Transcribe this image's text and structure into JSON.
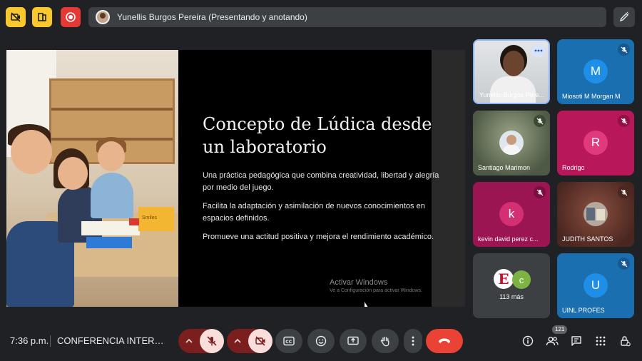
{
  "top_bar": {
    "presenter_status": "Yunellis Burgos Pereira (Presentando y anotando)"
  },
  "slide": {
    "title": "Concepto de Lúdica desde un laboratorio",
    "bullets": [
      "Una práctica pedagógica que combina creatividad, libertad y alegría por medio del juego.",
      "Facilita la adaptación y asimilación de nuevos conocimientos en espacios definidos.",
      "Promueve una actitud positiva y mejora el rendimiento académico."
    ],
    "toy_label": "Smiles",
    "watermark_title": "Activar Windows",
    "watermark_subtitle": "Ve a Configuración para activar Windows."
  },
  "participants": [
    {
      "name": "Yunellis Burgos Pere...",
      "type": "video"
    },
    {
      "name": "Miosoti M Morgan M",
      "initial": "M",
      "tile_color": "#1a6fb0",
      "avatar_color": "#1f8ee6"
    },
    {
      "name": "Santiago Marimon",
      "type": "video"
    },
    {
      "name": "Rodrigo",
      "initial": "R",
      "tile_color": "#b8185a",
      "avatar_color": "#e03a7c"
    },
    {
      "name": "kevin david perez c...",
      "initial": "k",
      "tile_color": "#9b1552",
      "avatar_color": "#d42f73"
    },
    {
      "name": "JUDITH SANTOS",
      "type": "video"
    },
    {
      "name": "UINL PROFES",
      "initial": "U",
      "tile_color": "#1a6fb0",
      "avatar_color": "#1f8ee6"
    }
  ],
  "more_tile": {
    "label": "113 más",
    "avatar1_initial": "E",
    "avatar2_initial": "c"
  },
  "bottom_bar": {
    "time": "7:36 p.m.",
    "meeting_name": "CONFERENCIA INTERNACIONAL",
    "people_count": "121"
  },
  "colors": {
    "accent_yellow": "#f9c72e",
    "record_red": "#e53935",
    "hangup_red": "#ea4335",
    "muted_bg": "#f9dedc"
  }
}
